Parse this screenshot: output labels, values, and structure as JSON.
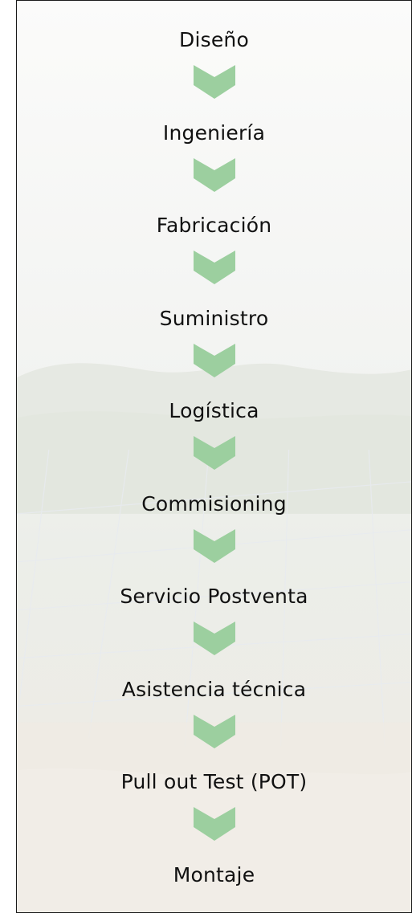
{
  "flow": {
    "steps": [
      "Diseño",
      "Ingeniería",
      "Fabricación",
      "Suministro",
      "Logística",
      "Commisioning",
      "Servicio Postventa",
      "Asistencia técnica",
      "Pull out Test (POT)",
      "Montaje"
    ],
    "arrow_icon": "chevron-down-icon",
    "arrow_color": "#9ccf9f",
    "text_color": "#111111",
    "frame_border_color": "#1a1a1a"
  }
}
